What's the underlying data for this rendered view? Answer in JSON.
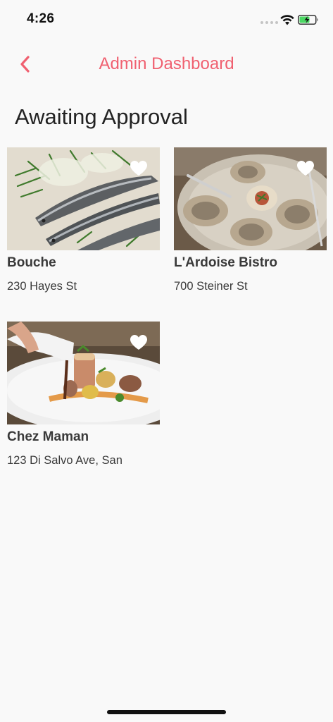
{
  "status_bar": {
    "time": "4:26"
  },
  "nav": {
    "title": "Admin Dashboard",
    "back_icon": "chevron-left-icon"
  },
  "section": {
    "title": "Awaiting Approval"
  },
  "restaurants": [
    {
      "name": "Bouche",
      "address": "230 Hayes St",
      "favorite_icon": "heart-icon"
    },
    {
      "name": "L'Ardoise Bistro",
      "address": "700 Steiner St",
      "favorite_icon": "heart-icon"
    },
    {
      "name": "Chez Maman",
      "address": "123 Di Salvo Ave, San",
      "favorite_icon": "heart-icon"
    }
  ],
  "colors": {
    "accent": "#f06070",
    "background": "#f9f9f9",
    "text": "#3a3a3a"
  }
}
